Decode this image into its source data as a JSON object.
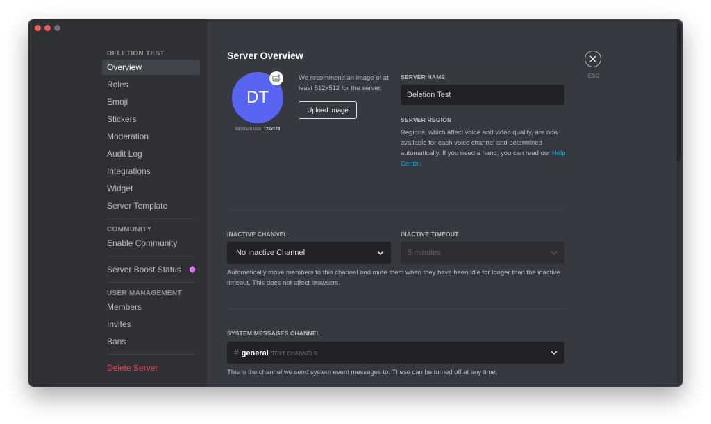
{
  "window": {
    "controls": [
      "close",
      "minimize",
      "maximize"
    ]
  },
  "sidebar": {
    "sections": [
      {
        "header": "DELETION TEST",
        "items": [
          {
            "label": "Overview",
            "active": true
          },
          {
            "label": "Roles"
          },
          {
            "label": "Emoji"
          },
          {
            "label": "Stickers"
          },
          {
            "label": "Moderation"
          },
          {
            "label": "Audit Log"
          },
          {
            "label": "Integrations"
          },
          {
            "label": "Widget"
          },
          {
            "label": "Server Template"
          }
        ]
      },
      {
        "header": "COMMUNITY",
        "items": [
          {
            "label": "Enable Community"
          }
        ]
      },
      {
        "header": "",
        "items": [
          {
            "label": "Server Boost Status",
            "icon": "boost-gem-icon"
          }
        ]
      },
      {
        "header": "USER MANAGEMENT",
        "items": [
          {
            "label": "Members"
          },
          {
            "label": "Invites"
          },
          {
            "label": "Bans"
          }
        ]
      },
      {
        "header": "",
        "items": [
          {
            "label": "Delete Server",
            "danger": true
          }
        ]
      }
    ]
  },
  "main": {
    "title": "Server Overview",
    "avatar": {
      "initials": "DT",
      "color": "#5865f2",
      "min_size_label": "Minimum Size: ",
      "min_size_value": "128x128"
    },
    "recommend_text": "We recommend an image of at least 512x512 for the server.",
    "upload_button": "Upload Image",
    "server_name": {
      "label": "SERVER NAME",
      "value": "Deletion Test"
    },
    "server_region": {
      "label": "SERVER REGION",
      "text": "Regions, which affect voice and video quality, are now available for each voice channel and determined automatically. If you need a hand, you can read our ",
      "link": "Help Center",
      "suffix": "."
    },
    "inactive_channel": {
      "label": "INACTIVE CHANNEL",
      "value": "No Inactive Channel"
    },
    "inactive_timeout": {
      "label": "INACTIVE TIMEOUT",
      "value": "5 minutes",
      "disabled": true
    },
    "inactive_help": "Automatically move members to this channel and mute them when they have been idle for longer than the inactive timeout. This does not affect browsers.",
    "system_channel": {
      "label": "SYSTEM MESSAGES CHANNEL",
      "hash": "#",
      "channel": "general",
      "category": "TEXT CHANNELS"
    },
    "system_help": "This is the channel we send system event messages to. These can be turned off at any time."
  },
  "close": {
    "esc_label": "ESC"
  },
  "colors": {
    "accent": "#5865f2",
    "link": "#00b0f4",
    "danger": "#ed4245",
    "boost": "#ff73fa"
  }
}
